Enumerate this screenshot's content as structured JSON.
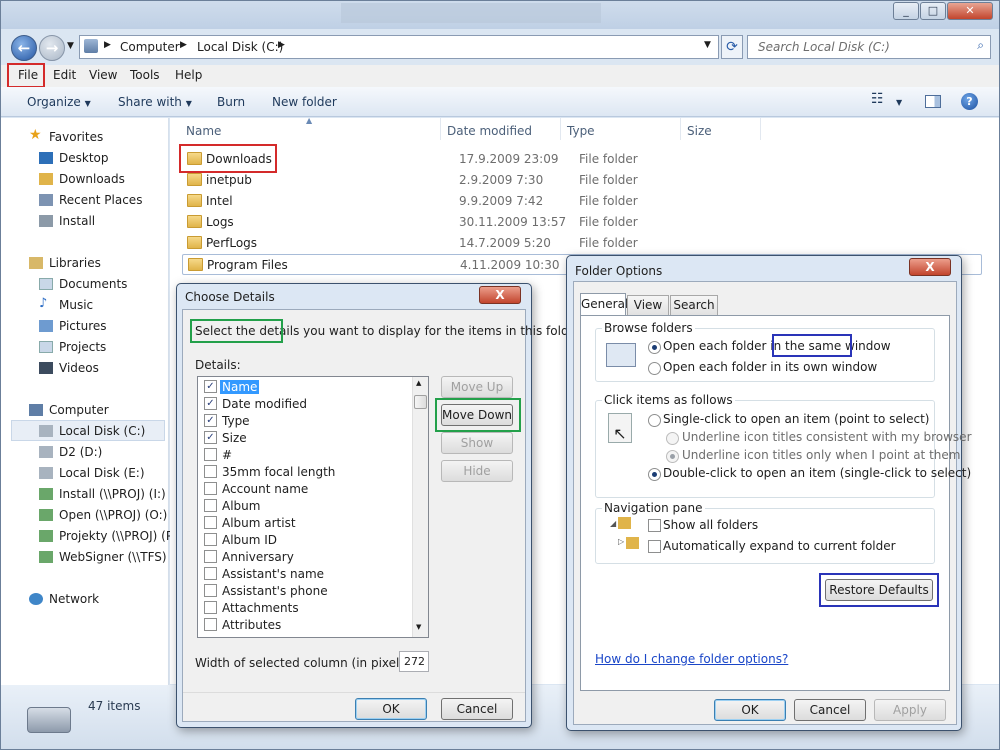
{
  "explorer": {
    "nav": {
      "back": "←",
      "forward": "→",
      "breadcrumb": [
        "Computer",
        "Local Disk (C:)"
      ],
      "search_placeholder": "Search Local Disk (C:)"
    },
    "menu": [
      "File",
      "Edit",
      "View",
      "Tools",
      "Help"
    ],
    "commands": [
      "Organize",
      "Share with",
      "Burn",
      "New folder"
    ],
    "columns": [
      "Name",
      "Date modified",
      "Type",
      "Size"
    ],
    "sidebar": {
      "favorites": {
        "label": "Favorites",
        "items": [
          "Desktop",
          "Downloads",
          "Recent Places",
          "Install"
        ]
      },
      "libraries": {
        "label": "Libraries",
        "items": [
          "Documents",
          "Music",
          "Pictures",
          "Projects",
          "Videos"
        ]
      },
      "computer": {
        "label": "Computer",
        "items": [
          "Local Disk (C:)",
          "D2 (D:)",
          "Local Disk (E:)",
          "Install (\\\\PROJ) (I:)",
          "Open (\\\\PROJ) (O:)",
          "Projekty (\\\\PROJ) (P",
          "WebSigner (\\\\TFS) ("
        ]
      },
      "network": "Network"
    },
    "files": [
      {
        "name": "Downloads",
        "date": "17.9.2009 23:09",
        "type": "File folder"
      },
      {
        "name": "inetpub",
        "date": "2.9.2009 7:30",
        "type": "File folder"
      },
      {
        "name": "Intel",
        "date": "9.9.2009 7:42",
        "type": "File folder"
      },
      {
        "name": "Logs",
        "date": "30.11.2009 13:57",
        "type": "File folder"
      },
      {
        "name": "PerfLogs",
        "date": "14.7.2009 5:20",
        "type": "File folder"
      },
      {
        "name": "Program Files",
        "date": "4.11.2009 10:30",
        "type": ""
      }
    ],
    "status": "47 items"
  },
  "choose_details": {
    "title": "Choose Details",
    "close": "X",
    "desc_hl": "Select the details",
    "desc_rest": " you want to display for the items in this folder.",
    "details_label": "Details:",
    "items": [
      {
        "label": "Name",
        "checked": true,
        "selected": true
      },
      {
        "label": "Date modified",
        "checked": true
      },
      {
        "label": "Type",
        "checked": true
      },
      {
        "label": "Size",
        "checked": true
      },
      {
        "label": "#",
        "checked": false
      },
      {
        "label": "35mm focal length",
        "checked": false
      },
      {
        "label": "Account name",
        "checked": false
      },
      {
        "label": "Album",
        "checked": false
      },
      {
        "label": "Album artist",
        "checked": false
      },
      {
        "label": "Album ID",
        "checked": false
      },
      {
        "label": "Anniversary",
        "checked": false
      },
      {
        "label": "Assistant's name",
        "checked": false
      },
      {
        "label": "Assistant's phone",
        "checked": false
      },
      {
        "label": "Attachments",
        "checked": false
      },
      {
        "label": "Attributes",
        "checked": false
      }
    ],
    "buttons": {
      "move_up": "Move Up",
      "move_down": "Move Down",
      "show": "Show",
      "hide": "Hide",
      "ok": "OK",
      "cancel": "Cancel"
    },
    "width_label": "Width of selected column (in pixels):",
    "width_value": "272"
  },
  "folder_options": {
    "title": "Folder Options",
    "close": "X",
    "tabs": [
      "General",
      "View",
      "Search"
    ],
    "browse": {
      "label": "Browse folders",
      "opt1_a": "Open each folder in the ",
      "opt1_b": "same window",
      "opt2": "Open each folder in its own window"
    },
    "click": {
      "label": "Click items as follows",
      "single": "Single-click to open an item (point to select)",
      "u1": "Underline icon titles consistent with my browser",
      "u2": "Underline icon titles only when I point at them",
      "double": "Double-click to open an item (single-click to select)"
    },
    "nav": {
      "label": "Navigation pane",
      "show_all": "Show all folders",
      "auto_expand": "Automatically expand to current folder"
    },
    "restore": "Restore Defaults",
    "link": "How do I change folder options?",
    "ok": "OK",
    "cancel": "Cancel",
    "apply": "Apply"
  },
  "colors": {
    "highlight_red": "#d42a2a",
    "highlight_green": "#23a04a",
    "highlight_blue": "#2a34b8",
    "link": "#1a46c8"
  }
}
